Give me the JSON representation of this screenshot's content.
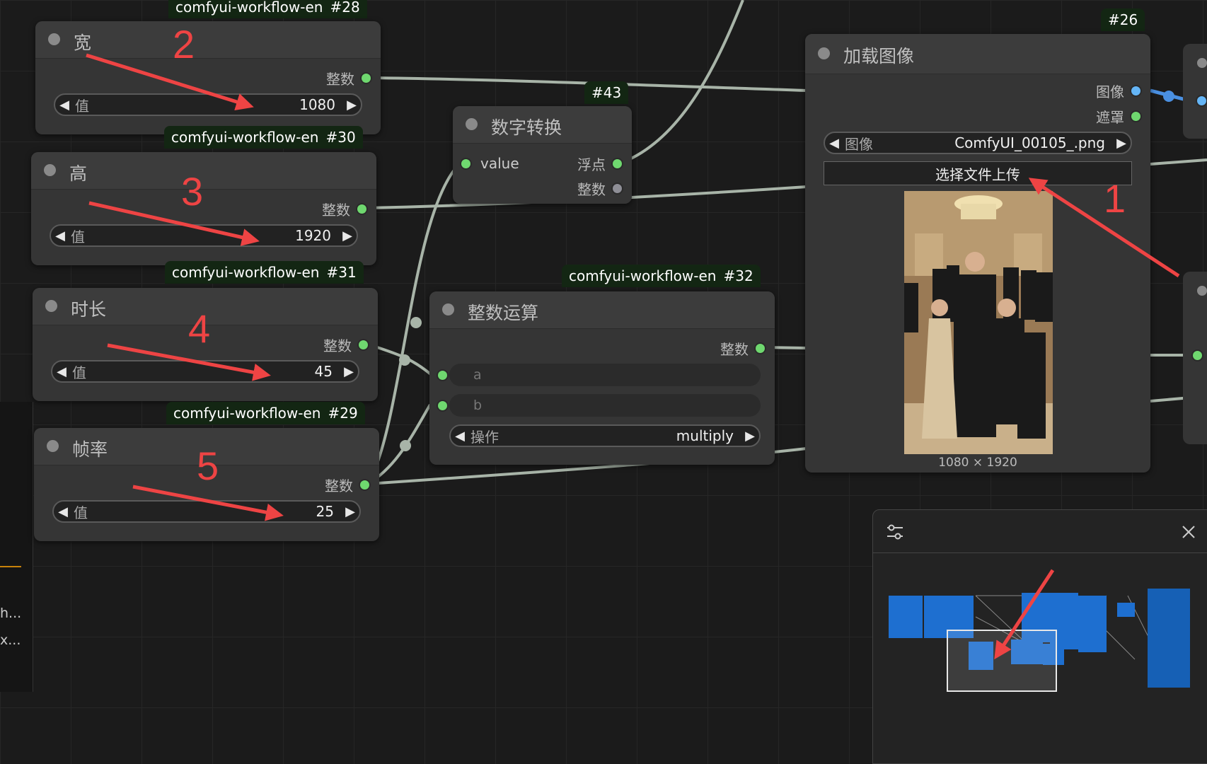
{
  "badges": {
    "n28": {
      "label": "comfyui-workflow-en",
      "id": "#28"
    },
    "n30": {
      "label": "comfyui-workflow-en",
      "id": "#30"
    },
    "n31": {
      "label": "comfyui-workflow-en",
      "id": "#31"
    },
    "n29": {
      "label": "comfyui-workflow-en",
      "id": "#29"
    },
    "n32": {
      "label": "comfyui-workflow-en",
      "id": "#32"
    },
    "n43": {
      "id": "#43"
    },
    "n26": {
      "id": "#26"
    }
  },
  "nodes": {
    "width": {
      "title": "宽",
      "output": "整数",
      "widget_label": "值",
      "value": "1080"
    },
    "height": {
      "title": "高",
      "output": "整数",
      "widget_label": "值",
      "value": "1920"
    },
    "duration": {
      "title": "时长",
      "output": "整数",
      "widget_label": "值",
      "value": "45"
    },
    "fps": {
      "title": "帧率",
      "output": "整数",
      "widget_label": "值",
      "value": "25"
    },
    "convert": {
      "title": "数字转换",
      "input": "value",
      "out_float": "浮点",
      "out_int": "整数"
    },
    "intop": {
      "title": "整数运算",
      "output": "整数",
      "input_a": "a",
      "input_b": "b",
      "op_label": "操作",
      "op_value": "multiply"
    },
    "load_image": {
      "title": "加载图像",
      "out_image": "图像",
      "out_mask": "遮罩",
      "widget_label": "图像",
      "file_value": "ComfyUI_00105_.png",
      "upload_label": "选择文件上传",
      "dimensions": "1080 × 1920"
    }
  },
  "annotations": {
    "n1": "1",
    "n2": "2",
    "n3": "3",
    "n4": "4",
    "n5": "5"
  },
  "left_panel": {
    "line1": "h...",
    "line2": "x..."
  },
  "minimap": {
    "settings_icon": "sliders-icon",
    "close_icon": "close-icon"
  },
  "colors": {
    "int_slot": "#6fd86f",
    "image_slot": "#64b5f6",
    "link": "#a8b4a8",
    "annotation": "#ee4444",
    "minimap_block": "#1e6fd0"
  }
}
